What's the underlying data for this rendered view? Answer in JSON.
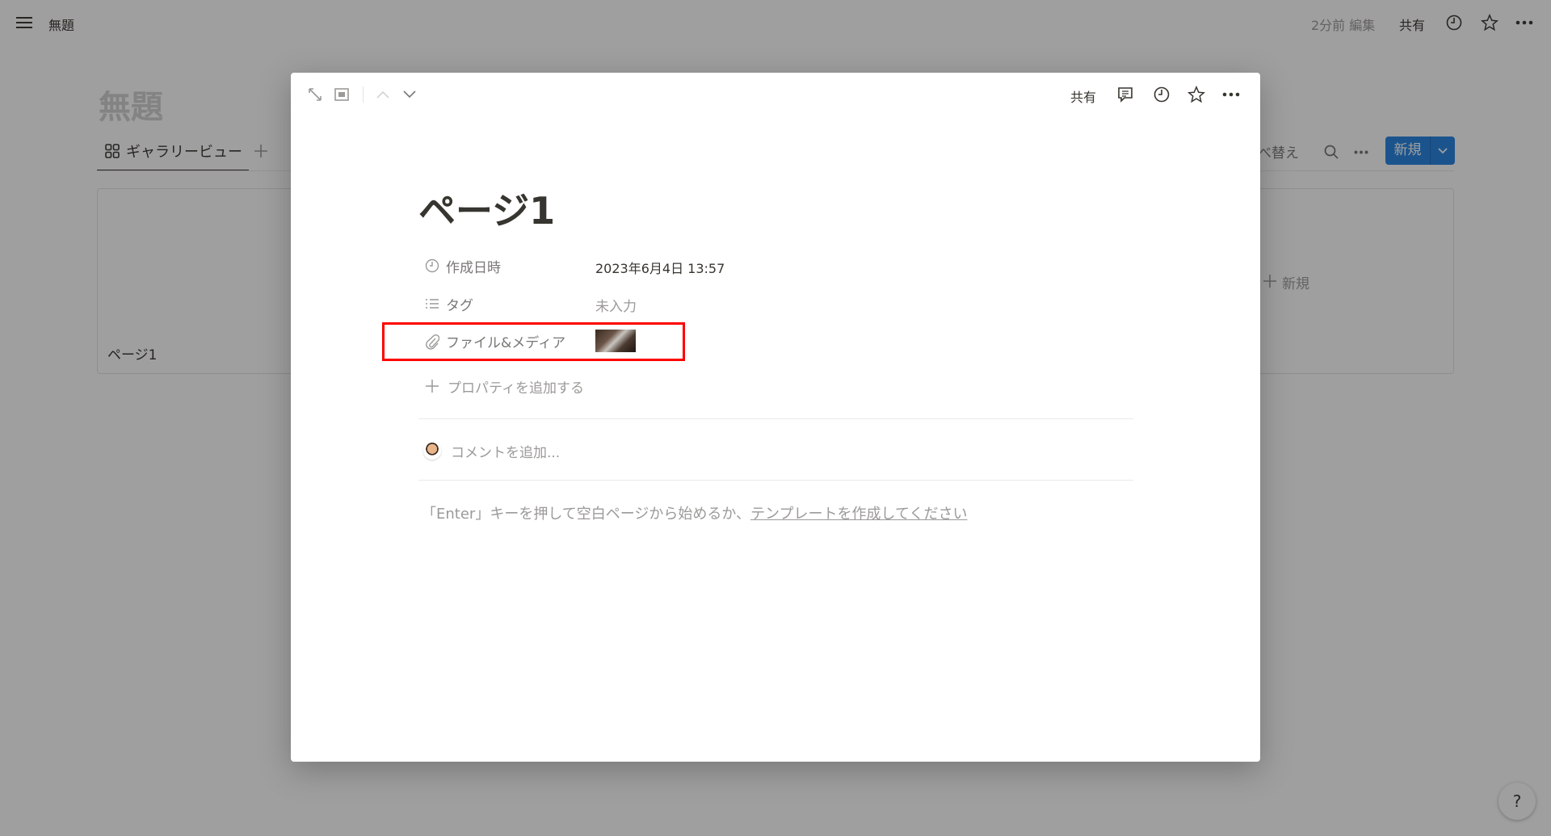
{
  "topbar": {
    "title": "無題",
    "edited": "2分前 編集",
    "share": "共有"
  },
  "page": {
    "title": "無題",
    "tab": "ギャラリービュー",
    "sort": "並べ替え",
    "new_button": "新規",
    "card_title": "ページ1",
    "add_new": "新規"
  },
  "modal": {
    "share": "共有",
    "title": "ページ1",
    "properties": [
      {
        "icon": "clock-icon",
        "label": "作成日時",
        "value": "2023年6月4日 13:57"
      },
      {
        "icon": "list-icon",
        "label": "タグ",
        "value": "未入力"
      },
      {
        "icon": "paperclip-icon",
        "label": "ファイル&メディア",
        "value": ""
      }
    ],
    "add_property": "プロパティを追加する",
    "comment_placeholder": "コメントを追加...",
    "empty_hint": "「Enter」キーを押して空白ページから始めるか、",
    "template_link": "テンプレートを作成してください"
  },
  "help": "?",
  "colors": {
    "highlight": "#ff0000",
    "accent": "#2383e2"
  }
}
